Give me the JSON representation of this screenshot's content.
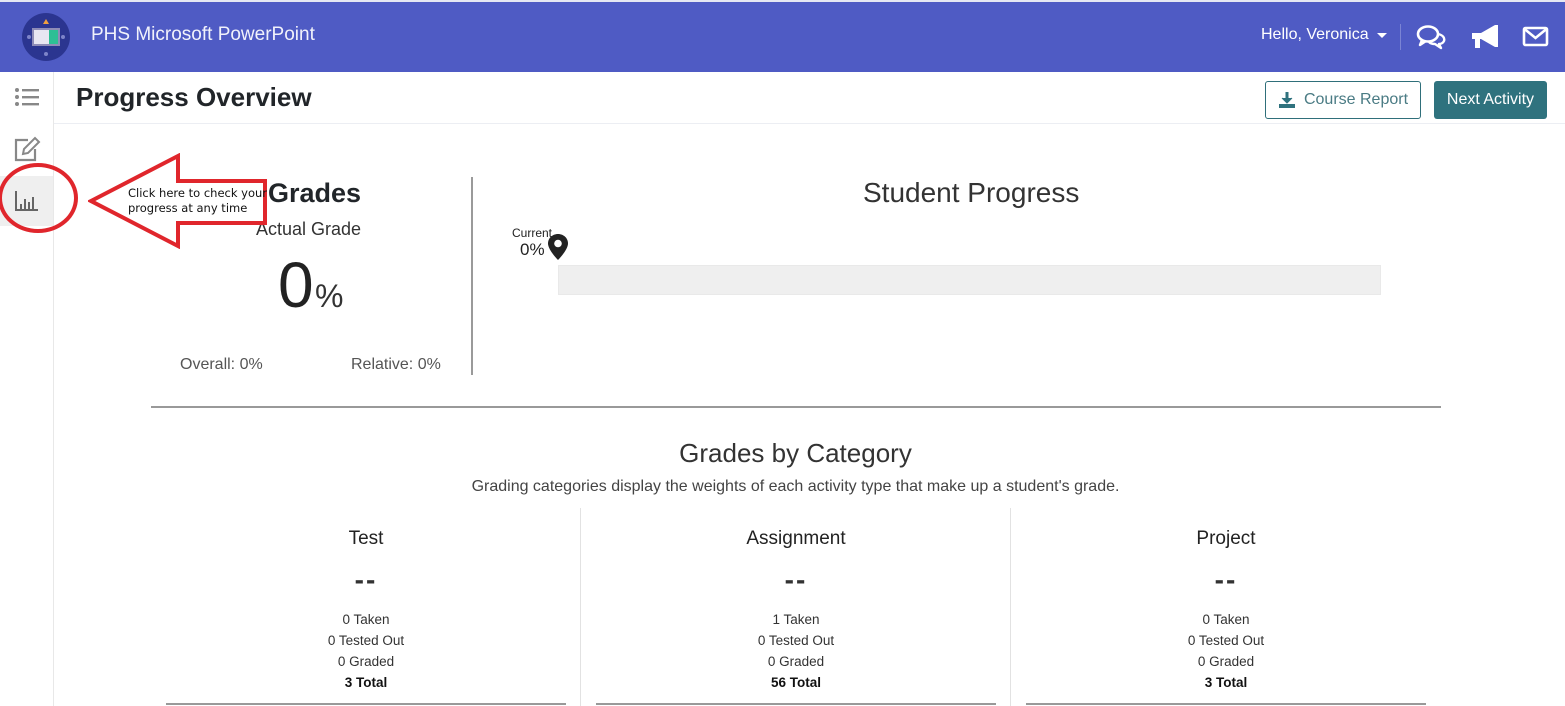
{
  "app": {
    "title": "PHS Microsoft PowerPoint",
    "logo_icon": "presentation-logo-icon"
  },
  "topbar": {
    "greeting": "Hello, Veronica",
    "icons": [
      "chat-icon",
      "megaphone-icon",
      "envelope-icon"
    ],
    "color": "#4f5bc4"
  },
  "sidebar": {
    "items": [
      {
        "icon": "list-icon",
        "label": "Course Outline",
        "active": false
      },
      {
        "icon": "edit-icon",
        "label": "Notes",
        "active": false
      },
      {
        "icon": "bar-chart-icon",
        "label": "Progress",
        "active": true
      }
    ]
  },
  "header": {
    "title": "Progress Overview",
    "course_report_label": "Course Report",
    "next_activity_label": "Next Activity",
    "accent": "#2f727e"
  },
  "grades": {
    "title": "Grades",
    "actual_label": "Actual Grade",
    "actual_value": "0",
    "actual_unit": "%",
    "overall": "Overall: 0%",
    "relative": "Relative: 0%"
  },
  "student_progress": {
    "title": "Student Progress",
    "current_label": "Current",
    "current_value": "0%",
    "progress_fraction": 0
  },
  "grades_by_category": {
    "title": "Grades by Category",
    "subtitle": "Grading categories display the weights of each activity type that make up a student's grade.",
    "categories": [
      {
        "name": "Test",
        "grade": "--",
        "taken": "0 Taken",
        "tested_out": "0 Tested Out",
        "graded": "0 Graded",
        "total": "3 Total"
      },
      {
        "name": "Assignment",
        "grade": "--",
        "taken": "1 Taken",
        "tested_out": "0 Tested Out",
        "graded": "0 Graded",
        "total": "56 Total"
      },
      {
        "name": "Project",
        "grade": "--",
        "taken": "0 Taken",
        "tested_out": "0 Tested Out",
        "graded": "0 Graded",
        "total": "3 Total"
      }
    ]
  },
  "annotation": {
    "text": "Click here to check your progress at any time",
    "color": "#e0262c"
  }
}
